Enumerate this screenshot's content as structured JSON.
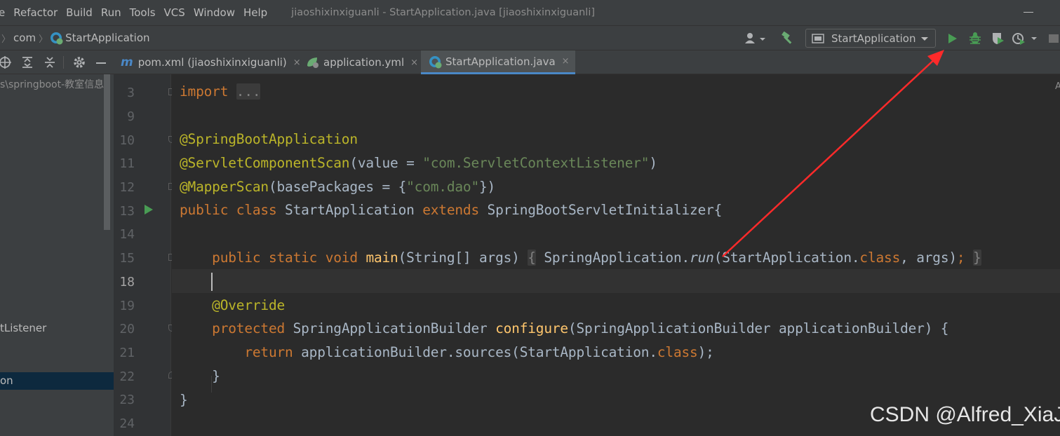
{
  "menu": [
    "e",
    "Refactor",
    "Build",
    "Run",
    "Tools",
    "VCS",
    "Window",
    "Help"
  ],
  "window_title": "jiaoshixinxiguanli - StartApplication.java [jiaoshixinxiguanli]",
  "breadcrumb": {
    "package": "com",
    "class": "StartApplication"
  },
  "run_config": {
    "selected": "StartApplication"
  },
  "tabs": [
    {
      "label": "pom.xml (jiaoshixinxiguanli)",
      "icon": "maven-icon",
      "close": "×"
    },
    {
      "label": "application.yml",
      "icon": "spring-leaf-icon",
      "close": "×"
    },
    {
      "label": "StartApplication.java",
      "icon": "spring-class-icon",
      "close": "×",
      "active": true
    }
  ],
  "sidebar": {
    "path": "s\\springboot-教室信息",
    "items": [
      "tListener",
      "on"
    ]
  },
  "line_numbers": [
    "3",
    "9",
    "10",
    "11",
    "12",
    "13",
    "14",
    "15",
    "18",
    "19",
    "20",
    "21",
    "22",
    "23",
    "24"
  ],
  "code": {
    "l3_import": "import ",
    "l3_fold": "...",
    "l10": "@SpringBootApplication",
    "l11_ann": "@ServletComponentScan",
    "l11_a": "(value = ",
    "l11_str": "\"com.ServletContextListener\"",
    "l11_b": ")",
    "l12_ann": "@MapperScan",
    "l12_a": "(basePackages = {",
    "l12_str": "\"com.dao\"",
    "l12_b": "})",
    "l13_kw1": "public class ",
    "l13_name": "StartApplication ",
    "l13_kw2": "extends ",
    "l13_rest": "SpringBootServletInitializer{",
    "l15_kw": "public static void ",
    "l15_fn": "main",
    "l15_a": "(String[] args) ",
    "l15_ob": "{",
    "l15_b": " SpringApplication.",
    "l15_run": "run",
    "l15_c": "(StartApplication.",
    "l15_class": "class",
    "l15_d": ", args)",
    "l15_semi": ";",
    "l15_cb": "}",
    "l19": "@Override",
    "l20_kw": "protected ",
    "l20_a": "SpringApplicationBuilder ",
    "l20_fn": "configure",
    "l20_b": "(SpringApplicationBuilder applicationBuilder) {",
    "l21_kw": "return ",
    "l21_a": "applicationBuilder.sources(StartApplication.",
    "l21_class": "class",
    "l21_b": ");",
    "l22": "}",
    "l23": "}"
  },
  "edge_char": "A",
  "watermark": "CSDN @Alfred_XiaJL",
  "colors": {
    "run": "#499c54",
    "debug": "#499c54",
    "annotation_arrow": "#ff2a2a",
    "keyword": "#cc7832",
    "annotation": "#bbb529",
    "string": "#6a8759"
  }
}
